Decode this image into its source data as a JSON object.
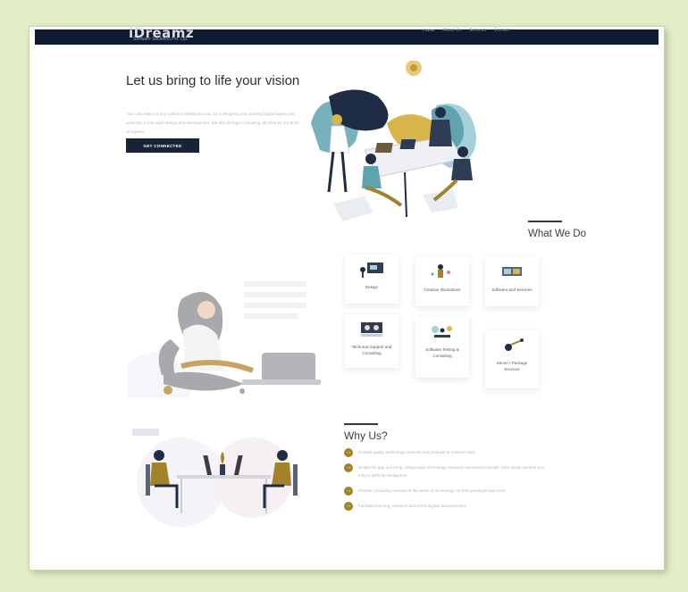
{
  "brand": {
    "name": "iDreamz",
    "tagline": "Software Solutions Pvt. Ltd."
  },
  "nav": {
    "items": [
      {
        "label": "Home",
        "active": true
      },
      {
        "label": "About Us",
        "active": false
      },
      {
        "label": "Services",
        "active": false
      },
      {
        "label": "Contact",
        "active": false
      }
    ]
  },
  "hero": {
    "title": "Let us bring to life your vision",
    "description": "Your own team for any software related process. be it designing and creating logical layers and contents or web apps design and development. We also do legal consulting, all done by our team of experts.",
    "cta_label": "GET CONNECTED"
  },
  "what_we_do": {
    "title": "What We Do",
    "services": [
      {
        "label": "Design"
      },
      {
        "label": "Creative Illustrations"
      },
      {
        "label": "Software and Services"
      },
      {
        "label": "Technical Support and Consulting"
      },
      {
        "label": "Software Testing & Consulting"
      },
      {
        "label": "Server / Package Services"
      }
    ]
  },
  "why_us": {
    "title": "Why Us?",
    "points": [
      "Provide quality technology services and products at nominal rates.",
      "Bridge the gap and bring cutting-edge technology research outcomes to people, from single variable ai to truly AI artificial intelligence.",
      "Provide consulting services in the areas of technology, tie-from prototype and more.",
      "Facilitate learning, research and technological advancement."
    ]
  },
  "colors": {
    "navbar": "#0e1b33",
    "accent_gold": "#a3822c",
    "teal": "#5fa3b0",
    "navy": "#2e3a4f"
  }
}
